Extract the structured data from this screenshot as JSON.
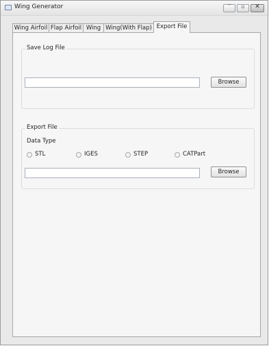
{
  "window": {
    "title": "Wing Generator",
    "controls": {
      "minimize": "–",
      "maximize": "▫",
      "close": "✕"
    }
  },
  "tabs": [
    {
      "label": "Wing Airfoil"
    },
    {
      "label": "Flap Airfoil"
    },
    {
      "label": "Wing"
    },
    {
      "label": "Wing(With Flap)"
    },
    {
      "label": "Export File"
    }
  ],
  "active_tab": "Export File",
  "save_log": {
    "group_title": "Save Log File",
    "path_value": "",
    "browse_label": "Browse"
  },
  "export": {
    "group_title": "Export File",
    "data_type_label": "Data Type",
    "options": [
      {
        "label": "STL"
      },
      {
        "label": "IGES"
      },
      {
        "label": "STEP"
      },
      {
        "label": "CATPart"
      }
    ],
    "selected_option": "",
    "path_value": "",
    "browse_label": "Browse"
  }
}
